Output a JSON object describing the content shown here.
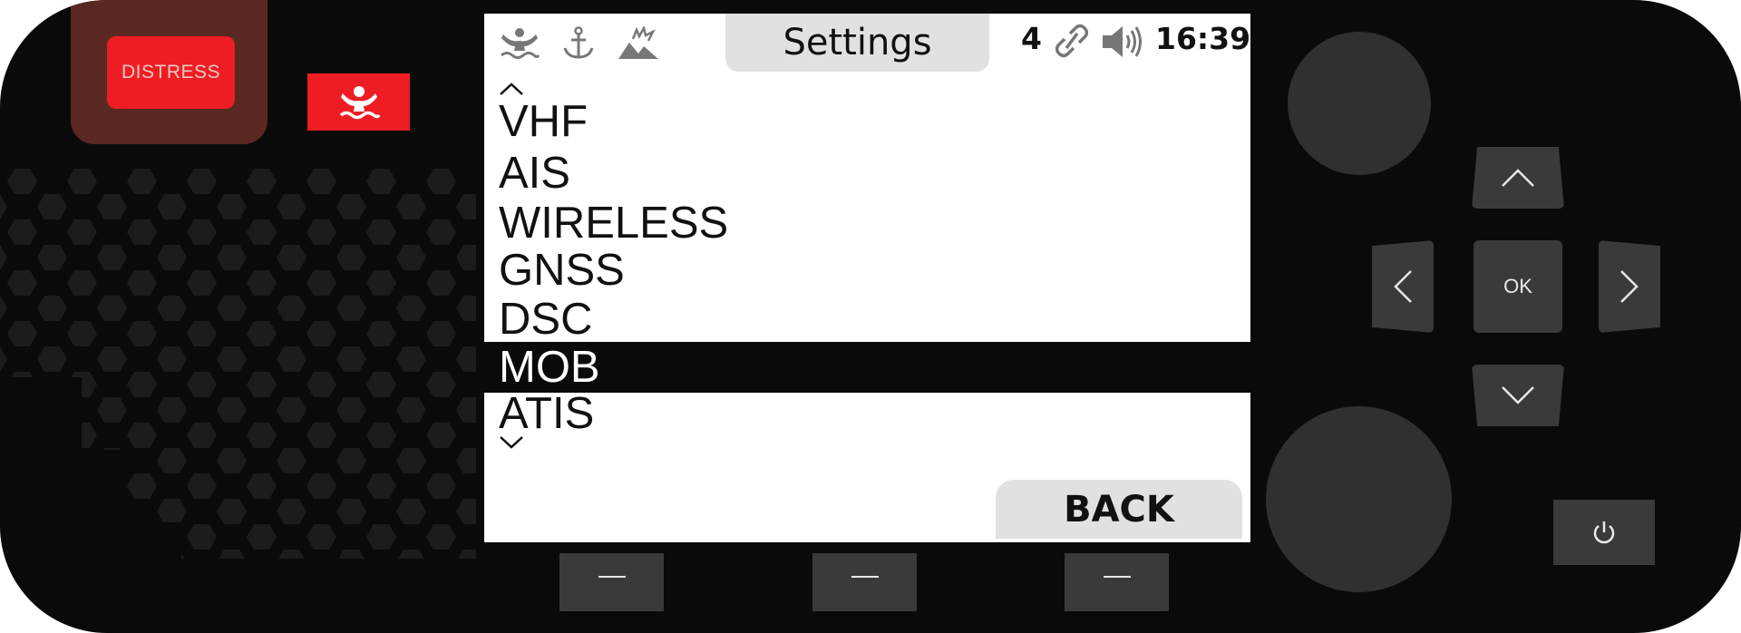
{
  "device": {
    "distress_label": "DISTRESS",
    "mob_icon": "man-overboard-icon"
  },
  "screen": {
    "title": "Settings",
    "status": {
      "icons": [
        "man-overboard-icon",
        "anchor-icon",
        "ship-aground-icon"
      ],
      "channel_count": "4",
      "link_icon": "link-icon",
      "volume_icon": "speaker-volume-icon",
      "time": "16:39"
    },
    "menu": {
      "items": [
        {
          "label": "VHF",
          "selected": false
        },
        {
          "label": "AIS",
          "selected": false
        },
        {
          "label": "WIRELESS",
          "selected": false
        },
        {
          "label": "GNSS",
          "selected": false
        },
        {
          "label": "DSC",
          "selected": false
        },
        {
          "label": "MOB",
          "selected": true
        },
        {
          "label": "ATIS",
          "selected": false
        }
      ],
      "scroll_up_icon": "chevron-up-icon",
      "scroll_down_icon": "chevron-down-icon"
    },
    "back_label": "BACK"
  },
  "softkeys": [
    "soft-key-1",
    "soft-key-2",
    "soft-key-3"
  ],
  "controls": {
    "ok_label": "OK",
    "power_icon": "power-icon"
  },
  "colors": {
    "body": "#0a0a0a",
    "distress_red": "#ee1d24",
    "distress_housing": "#5a2822",
    "button_gray": "#3b3a39",
    "knob_gray": "#303030",
    "screen_bg": "#ffffff",
    "tab_gray": "#e1e1e1",
    "selection": "#0a0a0a"
  }
}
